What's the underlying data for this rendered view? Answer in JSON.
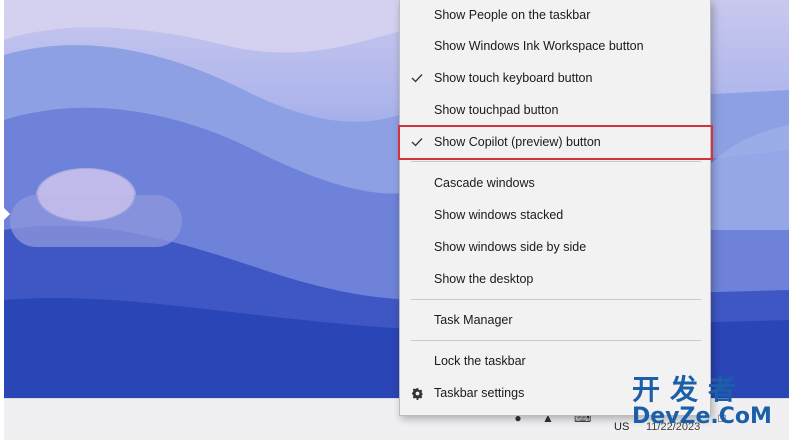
{
  "context_menu": {
    "items": [
      {
        "label": "Show People on the taskbar",
        "checked": false
      },
      {
        "label": "Show Windows Ink Workspace button",
        "checked": false
      },
      {
        "label": "Show touch keyboard button",
        "checked": true
      },
      {
        "label": "Show touchpad button",
        "checked": false
      },
      {
        "label": "Show Copilot (preview) button",
        "checked": true,
        "highlighted": true
      },
      {
        "label": "Cascade windows",
        "checked": false
      },
      {
        "label": "Show windows stacked",
        "checked": false
      },
      {
        "label": "Show windows side by side",
        "checked": false
      },
      {
        "label": "Show the desktop",
        "checked": false
      },
      {
        "label": "Task Manager",
        "checked": false
      },
      {
        "label": "Lock the taskbar",
        "checked": false
      },
      {
        "label": "Taskbar settings",
        "checked": false,
        "icon": "gear-icon"
      }
    ]
  },
  "taskbar": {
    "language": "US",
    "date_partial": "11/22/2023"
  },
  "watermark": {
    "chinese": "开发者",
    "english": "DevZe.CoM"
  },
  "colors": {
    "highlight_border": "#d3333c",
    "menu_background": "#f2f2f2",
    "watermark": "#1b5fa8"
  }
}
